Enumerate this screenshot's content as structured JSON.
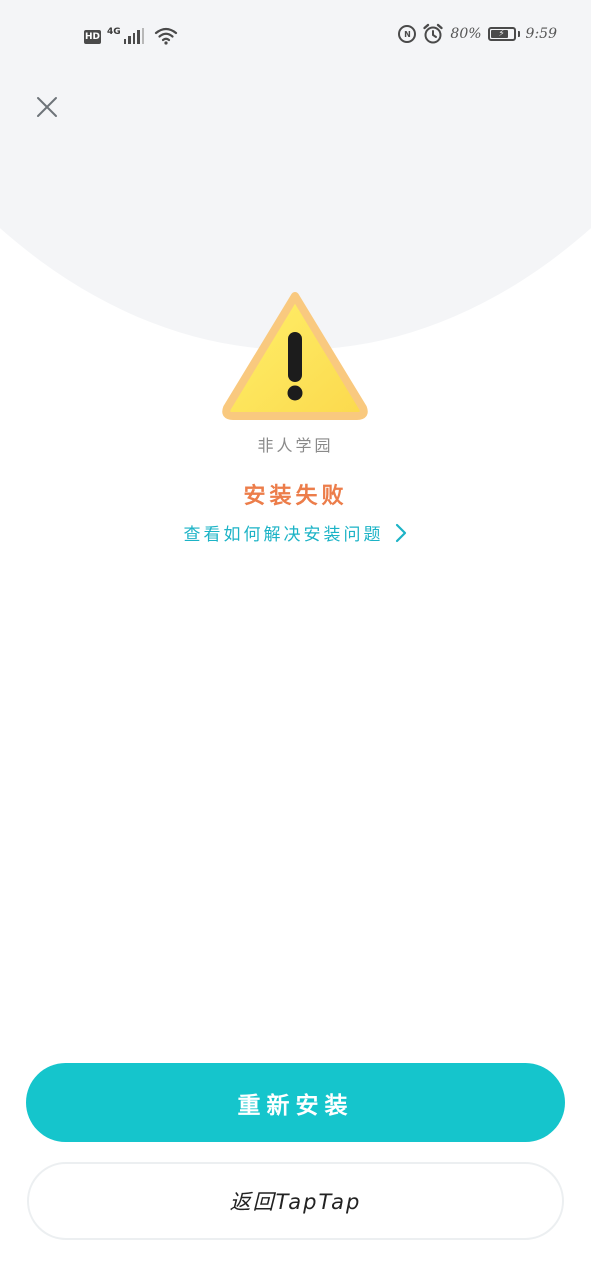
{
  "status_bar": {
    "hd_badge": "HD",
    "network_type": "4G",
    "nfc_badge": "N",
    "battery_percent": "80%",
    "battery_level": 0.8,
    "time": "9:59",
    "icons": [
      "hd-icon",
      "signal-icon",
      "wifi-icon",
      "nfc-icon",
      "alarm-icon",
      "battery-icon"
    ]
  },
  "header": {
    "close_icon": "close-icon"
  },
  "main": {
    "warning_icon": "warning-triangle-icon",
    "app_name": "非人学园",
    "status_title": "安装失败",
    "help_link_label": "查看如何解决安装问题"
  },
  "actions": {
    "reinstall_label": "重新安装",
    "back_label": "返回TapTap"
  },
  "colors": {
    "accent": "#15c5cc",
    "link": "#1cb3c6",
    "error": "#ec7d4a",
    "top_background": "#f4f5f7",
    "warning_fill": "#fde75a",
    "warning_border": "#f9c97f"
  }
}
